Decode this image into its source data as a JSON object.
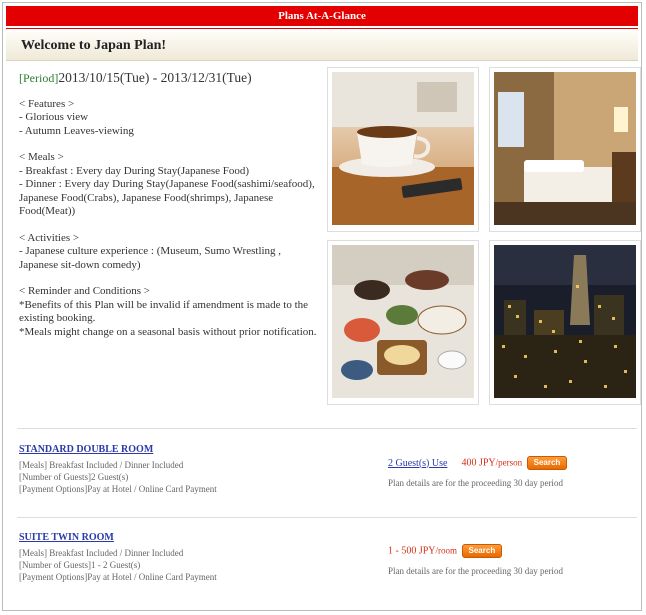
{
  "header": {
    "title": "Plans At-A-Glance"
  },
  "plan": {
    "welcome": "Welcome to Japan Plan!",
    "period_label": "[Period]",
    "period_value": "2013/10/15(Tue) - 2013/12/31(Tue)",
    "features_title": "< Features >",
    "features": [
      "- Glorious view",
      "- Autumn Leaves-viewing"
    ],
    "meals_title": "< Meals >",
    "meals": [
      "- Breakfast : Every day During Stay(Japanese Food)",
      "- Dinner : Every day During Stay(Japanese Food(sashimi/seafood), Japanese Food(Crabs), Japanese Food(shrimps), Japanese Food(Meat))"
    ],
    "activities_title": "< Activities >",
    "activities": [
      "- Japanese culture experience : (Museum, Sumo Wrestling , Japanese sit-down comedy)"
    ],
    "reminder_title": "< Reminder and Conditions >",
    "reminders": [
      "*Benefits of this Plan will be invalid if amendment is made to the existing booking.",
      "*Meals might change on a seasonal basis without prior notification."
    ]
  },
  "photos": [
    "coffee-cup-photo",
    "hotel-room-photo",
    "japanese-meal-photo",
    "city-night-view-photo"
  ],
  "rooms": [
    {
      "name": "STANDARD DOUBLE ROOM",
      "meals": "[Meals] Breakfast Included / Dinner Included",
      "guests_info": "[Number of Guests]2 Guest(s)",
      "payment": "[Payment Options]Pay at Hotel / Online Card Payment",
      "guests_link": "2 Guest(s) Use",
      "price": "400 JPY",
      "price_unit": "/person",
      "search": "Search",
      "note": "Plan details are for the proceeding 30 day period"
    },
    {
      "name": "SUITE TWIN ROOM",
      "meals": "[Meals] Breakfast Included / Dinner Included",
      "guests_info": "[Number of Guests]1 - 2 Guest(s)",
      "payment": "[Payment Options]Pay at Hotel / Online Card Payment",
      "price": "1 - 500 JPY",
      "price_unit": "/room",
      "search": "Search",
      "note": "Plan details are for the proceeding 30 day period"
    }
  ],
  "colors": {
    "header_red": "#e30000",
    "link_blue": "#2a3aa8",
    "price_red": "#d32f1a",
    "button_orange": "#f08020"
  }
}
